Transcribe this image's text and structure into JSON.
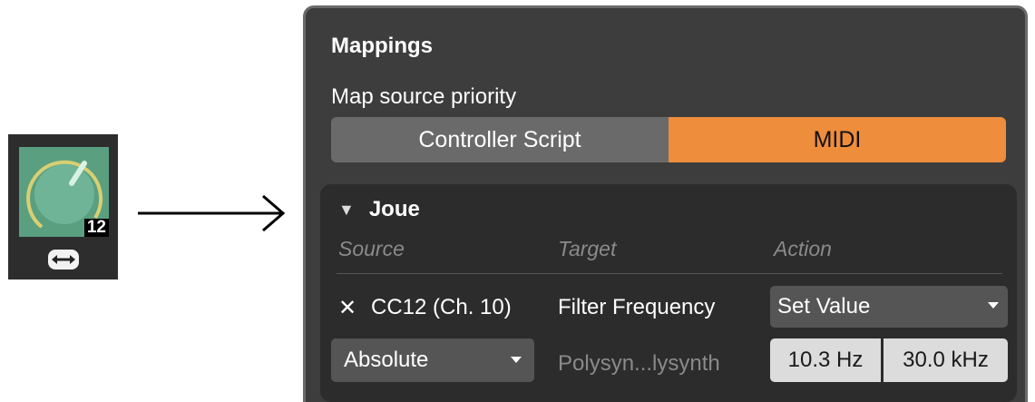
{
  "knob": {
    "value": "12",
    "knob_icon": "knob-icon",
    "mode_icon": "bidirectional-arrow-icon"
  },
  "connector": {
    "icon": "right-arrow-icon"
  },
  "panel": {
    "title": "Mappings",
    "priority_label": "Map source priority",
    "priority_options": [
      "Controller Script",
      "MIDI"
    ],
    "priority_selected": "MIDI"
  },
  "group": {
    "name": "Joue",
    "columns": {
      "source": "Source",
      "target": "Target",
      "action": "Action"
    },
    "mapping": {
      "remove_symbol": "✕",
      "source": "CC12 (Ch. 10)",
      "target": "Filter Frequency",
      "action": "Set Value",
      "mode": "Absolute",
      "device": "Polysyn...lysynth",
      "range_min": "10.3 Hz",
      "range_max": "30.0 kHz"
    }
  },
  "colors": {
    "accent": "#ee8d3c",
    "knob_face": "#5a9f80",
    "panel_bg": "#3d3d3d",
    "group_bg": "#2c2c2c"
  }
}
